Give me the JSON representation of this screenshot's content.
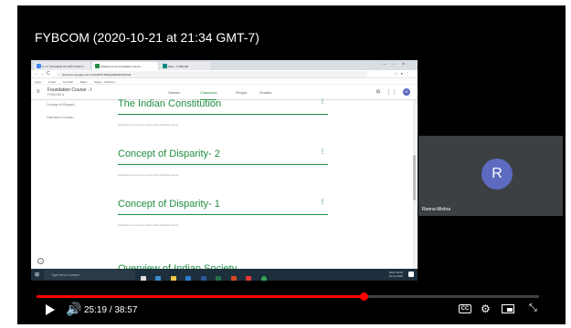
{
  "video": {
    "title": "FYBCOM (2020-10-21 at 21:34 GMT-7)",
    "current_time": "25:19",
    "separator": " / ",
    "duration": "38:57",
    "progress_fraction": 0.65
  },
  "browser": {
    "tabs": [
      {
        "label": "S.I.T. COLLEGE OF ARTS AND C...",
        "color": "#4285f4"
      },
      {
        "label": "Classroom for Foundation Cours...",
        "color": "#1e8e3e"
      },
      {
        "label": "Meet - FYBCOM",
        "color": "#00897b"
      }
    ],
    "url": "classroom.google.com/u/1/w/MTU1NDg1MjM4NzMz/t/all",
    "bookmarks": [
      "Apps",
      "Gmail",
      "YouTube",
      "Maps",
      "Skype - Wiphinm..."
    ]
  },
  "classroom": {
    "course_name": "Foundation Course - I",
    "course_section": "FYBCOM A",
    "tabs": [
      "Stream",
      "Classwork",
      "People",
      "Grades"
    ],
    "active_tab": "Classwork",
    "avatar_initial": "R",
    "side_links": [
      "Concept of Disparit...",
      "Overview of Indian..."
    ],
    "topics": [
      {
        "title": "The Indian Constitution",
        "note": "Students can only see topics with published posts"
      },
      {
        "title": "Concept of Disparity- 2",
        "note": "Students can only see topics with published posts"
      },
      {
        "title": "Concept of Disparity- 1",
        "note": "Students can only see topics with published posts"
      },
      {
        "title": "Overview of Indian Society",
        "note": ""
      }
    ]
  },
  "taskbar": {
    "search_placeholder": "Type here to search",
    "tray_time": "10:04",
    "tray_date": "22-10-2020",
    "tray_lang": "ENG"
  },
  "participant": {
    "initial": "R",
    "name": "Reena Mishra",
    "avatar_color": "#5c6bc0"
  }
}
